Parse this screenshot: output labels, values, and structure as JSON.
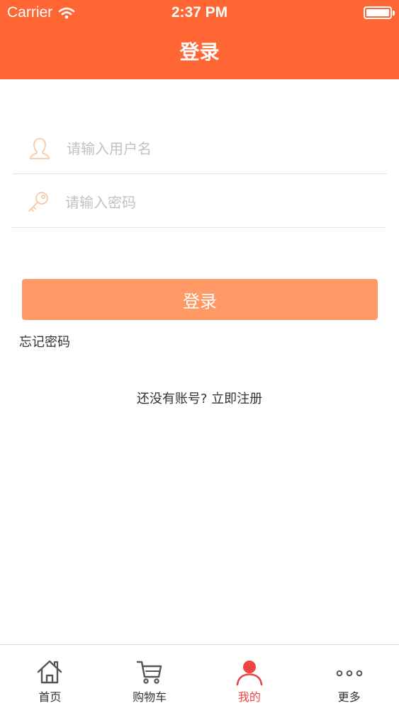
{
  "status_bar": {
    "carrier": "Carrier",
    "time": "2:37 PM"
  },
  "header": {
    "title": "登录"
  },
  "form": {
    "username_placeholder": "请输入用户名",
    "password_placeholder": "请输入密码",
    "login_label": "登录",
    "forgot_label": "忘记密码",
    "register_label": "还没有账号? 立即注册"
  },
  "tabbar": {
    "items": [
      {
        "label": "首页",
        "icon": "home-icon"
      },
      {
        "label": "购物车",
        "icon": "cart-icon"
      },
      {
        "label": "我的",
        "icon": "user-icon"
      },
      {
        "label": "更多",
        "icon": "more-icon"
      }
    ],
    "active": "我的"
  },
  "colors": {
    "brand": "#FF6633",
    "button": "#FF9966",
    "icon_tint": "#F5C9A8",
    "tab_active": "#EE4444",
    "tab_inactive": "#555555"
  }
}
